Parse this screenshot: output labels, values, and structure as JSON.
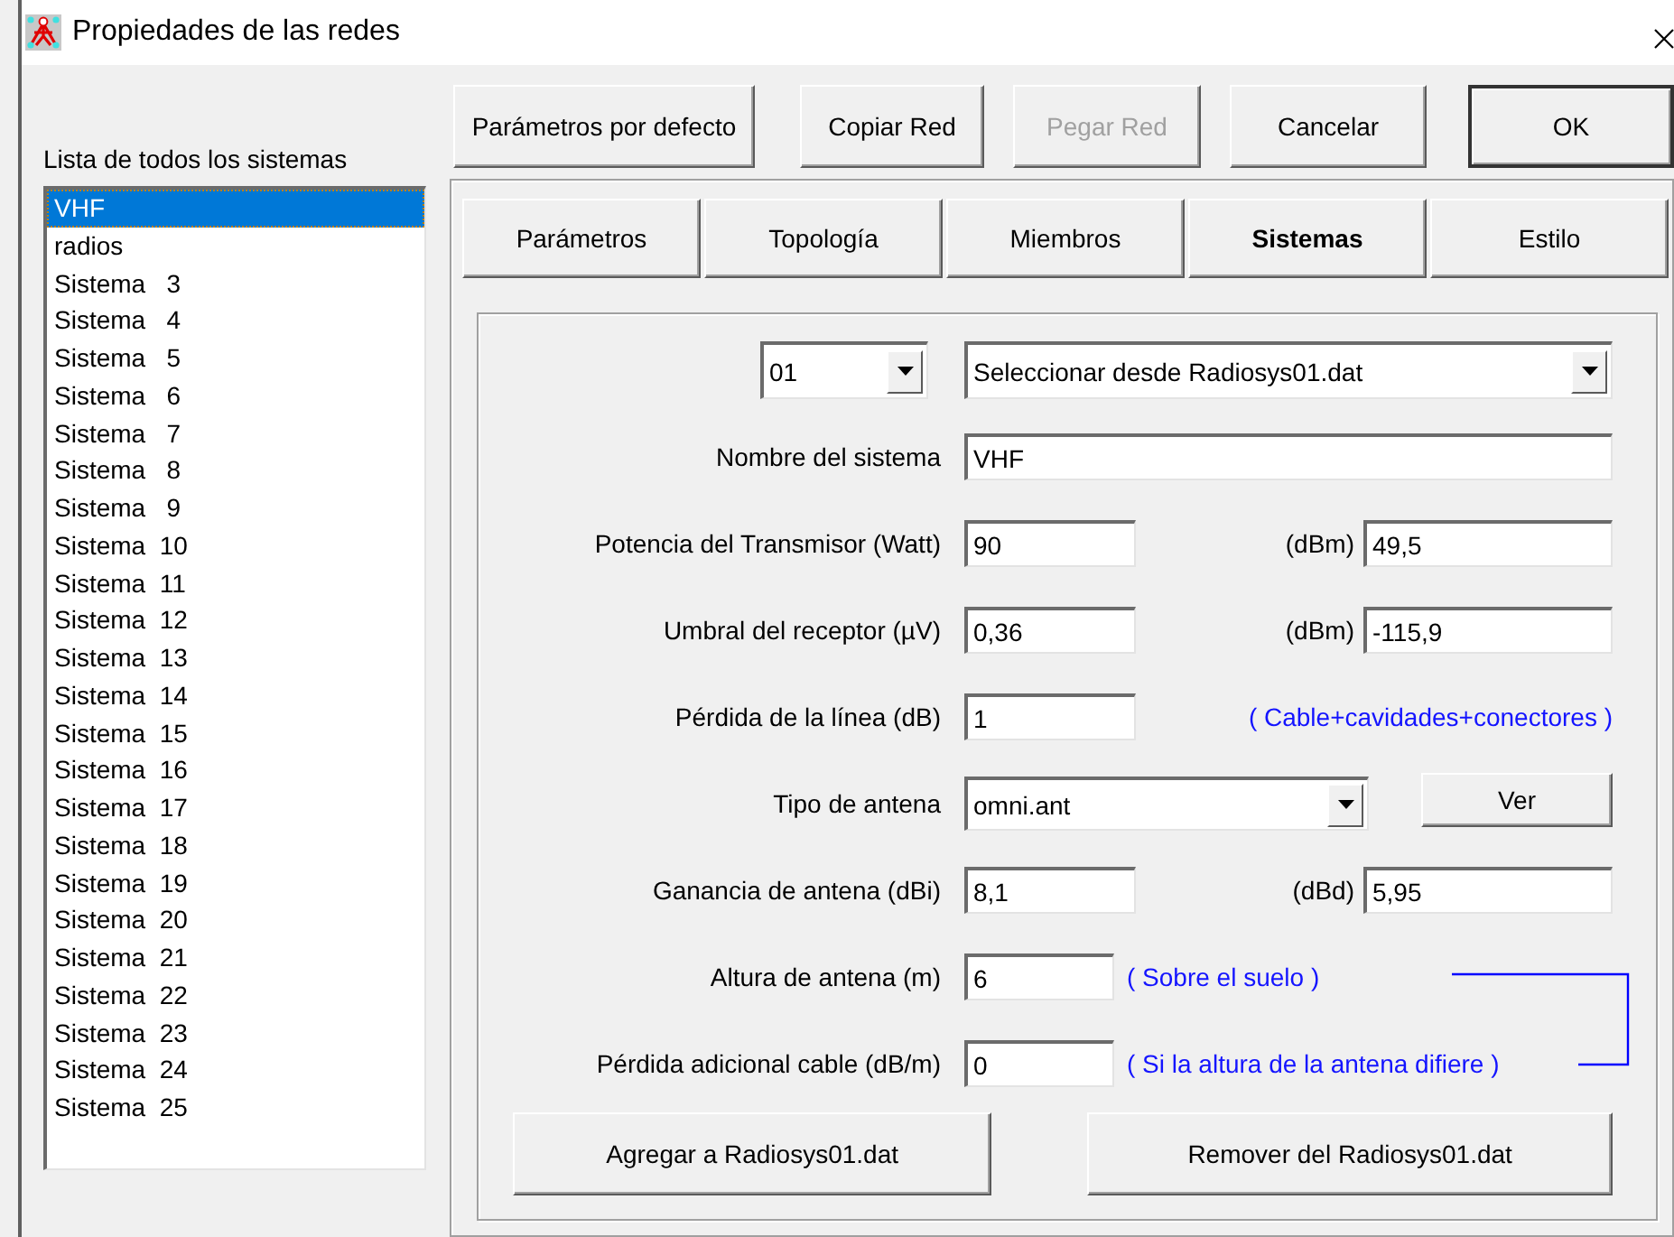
{
  "window": {
    "title": "Propiedades de las redes"
  },
  "systems_list": {
    "label": "Lista de todos los sistemas",
    "items": [
      {
        "label": "VHF",
        "selected": true
      },
      {
        "label": "radios",
        "selected": false
      },
      {
        "label": "Sistema   3",
        "selected": false
      },
      {
        "label": "Sistema   4",
        "selected": false
      },
      {
        "label": "Sistema   5",
        "selected": false
      },
      {
        "label": "Sistema   6",
        "selected": false
      },
      {
        "label": "Sistema   7",
        "selected": false
      },
      {
        "label": "Sistema   8",
        "selected": false
      },
      {
        "label": "Sistema   9",
        "selected": false
      },
      {
        "label": "Sistema  10",
        "selected": false
      },
      {
        "label": "Sistema  11",
        "selected": false
      },
      {
        "label": "Sistema  12",
        "selected": false
      },
      {
        "label": "Sistema  13",
        "selected": false
      },
      {
        "label": "Sistema  14",
        "selected": false
      },
      {
        "label": "Sistema  15",
        "selected": false
      },
      {
        "label": "Sistema  16",
        "selected": false
      },
      {
        "label": "Sistema  17",
        "selected": false
      },
      {
        "label": "Sistema  18",
        "selected": false
      },
      {
        "label": "Sistema  19",
        "selected": false
      },
      {
        "label": "Sistema  20",
        "selected": false
      },
      {
        "label": "Sistema  21",
        "selected": false
      },
      {
        "label": "Sistema  22",
        "selected": false
      },
      {
        "label": "Sistema  23",
        "selected": false
      },
      {
        "label": "Sistema  24",
        "selected": false
      },
      {
        "label": "Sistema  25",
        "selected": false
      }
    ]
  },
  "toolbar": [
    {
      "label": "Parámetros por defecto",
      "disabled": false,
      "default": false
    },
    {
      "label": "Copiar Red",
      "disabled": false,
      "default": false
    },
    {
      "label": "Pegar Red",
      "disabled": true,
      "default": false
    },
    {
      "label": "Cancelar",
      "disabled": false,
      "default": false
    },
    {
      "label": "OK",
      "disabled": false,
      "default": true
    }
  ],
  "tabs": [
    {
      "label": "Parámetros",
      "selected": false
    },
    {
      "label": "Topología",
      "selected": false
    },
    {
      "label": "Miembros",
      "selected": false
    },
    {
      "label": "Sistemas",
      "selected": true
    },
    {
      "label": "Estilo",
      "selected": false
    }
  ],
  "system": {
    "number": "01",
    "source": "Seleccionar desde Radiosys01.dat"
  },
  "rows": [
    {
      "kind": "name",
      "label": "Nombre del sistema",
      "value": "VHF"
    },
    {
      "kind": "pair",
      "label": "Potencia del Transmisor (Watt)",
      "value": "90",
      "unit": "(dBm)",
      "value2": "49,5"
    },
    {
      "kind": "pair",
      "label": "Umbral del receptor (µV)",
      "value": "0,36",
      "unit": "(dBm)",
      "value2": "-115,9"
    },
    {
      "kind": "note",
      "label": "Pérdida de la línea (dB)",
      "value": "1",
      "note": "( Cable+cavidades+conectores )"
    },
    {
      "kind": "combo",
      "label": "Tipo de antena",
      "value": "omni.ant",
      "button": "Ver"
    },
    {
      "kind": "pair",
      "label": "Ganancia de antena (dBi)",
      "value": "8,1",
      "unit": "(dBd)",
      "value2": "5,95"
    },
    {
      "kind": "hint",
      "label": "Altura de antena (m)",
      "value": "6",
      "note": "( Sobre el suelo )"
    },
    {
      "kind": "hint",
      "label": "Pérdida adicional cable (dB/m)",
      "value": "0",
      "note": "( Si la altura de la antena difiere )"
    }
  ],
  "actions": [
    "Agregar a Radiosys01.dat",
    "Remover del Radiosys01.dat"
  ]
}
